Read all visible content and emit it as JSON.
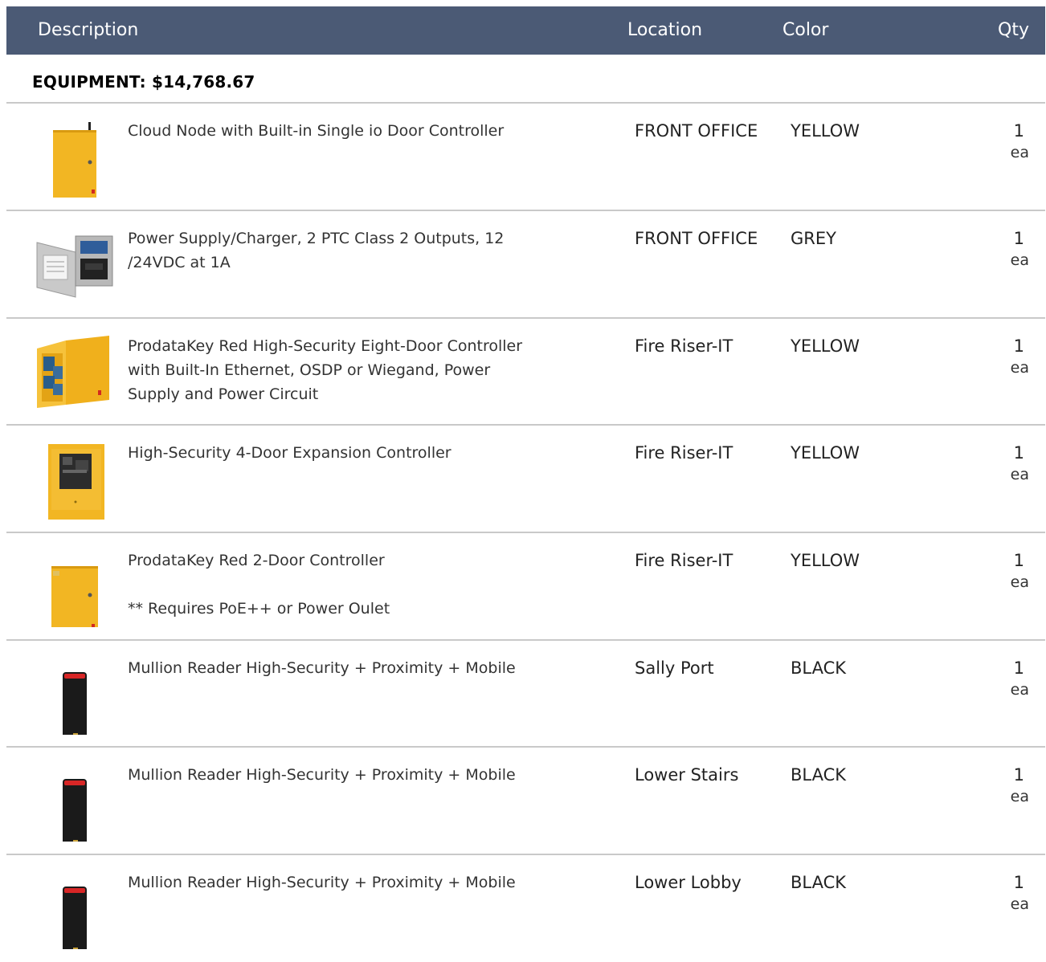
{
  "header": {
    "description": "Description",
    "location": "Location",
    "color": "Color",
    "qty": "Qty"
  },
  "section": {
    "title": "EQUIPMENT: $14,768.67"
  },
  "items": [
    {
      "description": "Cloud Node with Built-in Single io Door Controller",
      "note": "",
      "location": "FRONT OFFICE",
      "color": "YELLOW",
      "qty": "1",
      "unit": "ea",
      "image": "yellow-cloud-node-box"
    },
    {
      "description": "Power Supply/Charger, 2 PTC Class 2 Outputs, 12 /24VDC at 1A",
      "note": "",
      "location": "FRONT OFFICE",
      "color": "GREY",
      "qty": "1",
      "unit": "ea",
      "image": "grey-power-supply-open"
    },
    {
      "description": "ProdataKey Red High-Security Eight-Door Controller with Built-In Ethernet, OSDP or Wiegand, Power Supply and Power Circuit",
      "note": "",
      "location": "Fire Riser-IT",
      "color": "YELLOW",
      "qty": "1",
      "unit": "ea",
      "image": "yellow-eight-door-controller-open"
    },
    {
      "description": "High-Security 4-Door Expansion Controller",
      "note": "",
      "location": "Fire Riser-IT",
      "color": "YELLOW",
      "qty": "1",
      "unit": "ea",
      "image": "yellow-four-door-controller-open"
    },
    {
      "description": "ProdataKey Red 2-Door Controller",
      "note": "** Requires PoE++ or Power Oulet",
      "location": "Fire Riser-IT",
      "color": "YELLOW",
      "qty": "1",
      "unit": "ea",
      "image": "yellow-two-door-controller-box"
    },
    {
      "description": "Mullion Reader High-Security + Proximity + Mobile",
      "note": "",
      "location": "Sally Port",
      "color": "BLACK",
      "qty": "1",
      "unit": "ea",
      "image": "black-mullion-reader"
    },
    {
      "description": "Mullion Reader High-Security + Proximity + Mobile",
      "note": "",
      "location": "Lower Stairs",
      "color": "BLACK",
      "qty": "1",
      "unit": "ea",
      "image": "black-mullion-reader"
    },
    {
      "description": "Mullion Reader High-Security + Proximity + Mobile",
      "note": "",
      "location": "Lower Lobby",
      "color": "BLACK",
      "qty": "1",
      "unit": "ea",
      "image": "black-mullion-reader"
    }
  ]
}
